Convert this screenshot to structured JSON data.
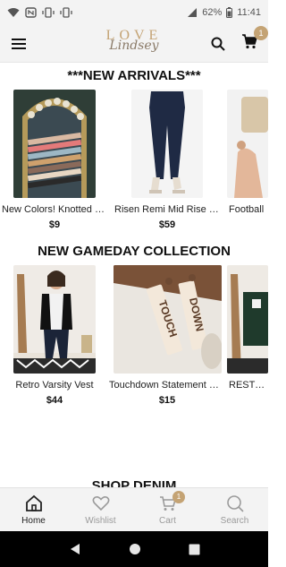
{
  "status_bar": {
    "battery": "62%",
    "time": "11:41",
    "icons": [
      "wifi-icon",
      "nfc-icon",
      "vibrate-icon",
      "signal-icon",
      "battery-icon"
    ]
  },
  "header": {
    "logo_top": "LOVE",
    "logo_script": "Lindsey",
    "cart_count": "1",
    "icons": [
      "menu-icon",
      "search-icon",
      "cart-icon"
    ],
    "accent_color": "#c4a374"
  },
  "sections": [
    {
      "title": "***NEW ARRIVALS***",
      "products": [
        {
          "name": "New Colors! Knotted Hair Ties",
          "price": "$9"
        },
        {
          "name": "Risen Remi Mid Rise Jeans",
          "price": "$59"
        },
        {
          "name": "Football",
          "price": ""
        }
      ]
    },
    {
      "title": "NEW GAMEDAY COLLECTION",
      "products": [
        {
          "name": "Retro Varsity Vest",
          "price": "$44"
        },
        {
          "name": "Touchdown Statement Earrings",
          "price": "$15"
        },
        {
          "name": "RESTOCK",
          "price": ""
        }
      ]
    },
    {
      "title": "SHOP DENIM"
    }
  ],
  "earring_words": [
    "TOUCH",
    "DOWN"
  ],
  "bottom_nav": {
    "items": [
      {
        "label": "Home",
        "icon": "home-icon",
        "active": true
      },
      {
        "label": "Wishlist",
        "icon": "heart-icon",
        "active": false
      },
      {
        "label": "Cart",
        "icon": "cart-icon",
        "active": false,
        "badge": "1"
      },
      {
        "label": "Search",
        "icon": "search-icon",
        "active": false
      }
    ]
  },
  "system_nav": [
    "back-icon",
    "home-circle-icon",
    "recents-icon"
  ]
}
